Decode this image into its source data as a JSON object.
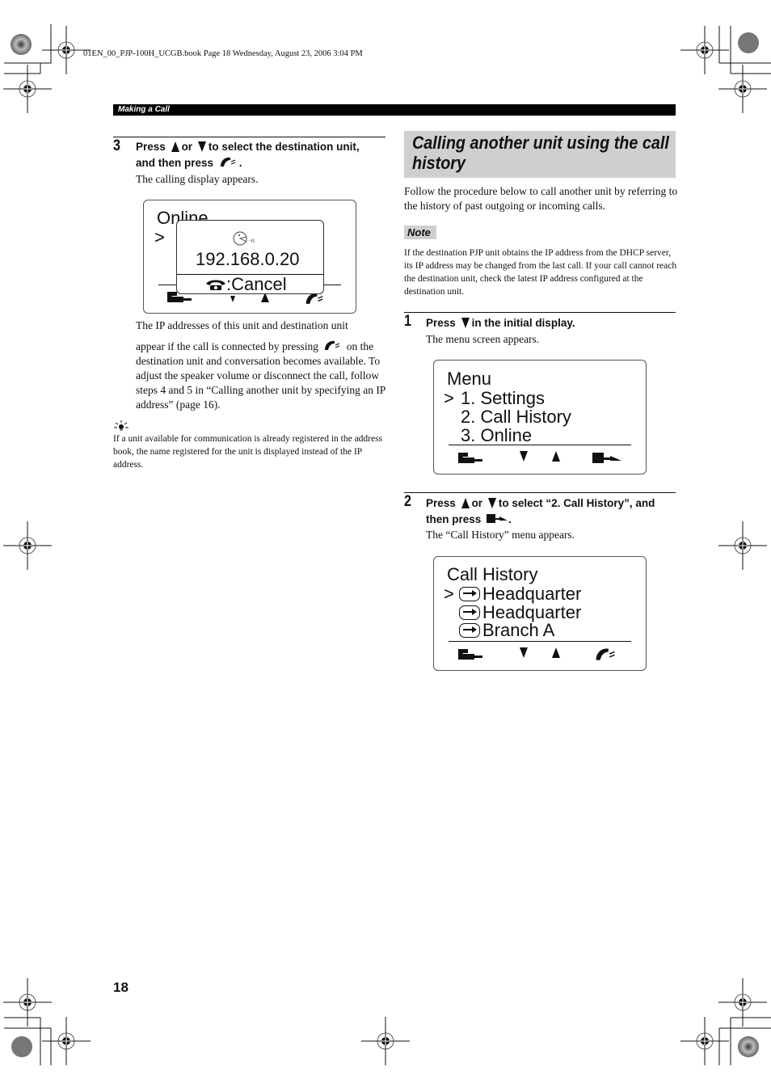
{
  "print_header": {
    "file_info": "01EN_00_PJP-100H_UCGB.book  Page 18  Wednesday, August 23, 2006  3:04 PM"
  },
  "section": {
    "label": "Making a Call"
  },
  "left_column": {
    "step3": {
      "number": "3",
      "line1_a": "Press",
      "line1_or": "or",
      "line1_b": "to select the destination unit,",
      "line2": "and then press",
      "line2_end": ".",
      "result": "The calling display appears."
    },
    "calling_display": {
      "background_title": "Online",
      "cursor": ">",
      "ip_address": "192.168.0.20",
      "cancel_label": ":Cancel"
    },
    "paragraph_line1": "The IP addresses of this unit and destination unit",
    "paragraph_line2a": "appear if the call is connected by pressing",
    "paragraph_line2b": "on the",
    "paragraph_rest": "destination unit and conversation becomes available. To adjust the speaker volume or disconnect the call, follow steps 4 and 5 in “Calling another unit by specifying an IP address” (page 16).",
    "hint": {
      "icon": "lightbulb-icon",
      "text": "If a unit available for communication is already registered in the address book, the name registered for the unit is displayed instead of the IP address."
    }
  },
  "right_column": {
    "heading": "Calling another unit using the call history",
    "intro": "Follow the procedure below to call another unit by referring to the history of past outgoing or incoming calls.",
    "note": {
      "label": "Note",
      "text": "If the destination PJP unit obtains the IP address from the DHCP server, its IP address may be changed from the last call. If your call cannot reach the destination unit, check the latest IP address configured at the destination unit."
    },
    "step1": {
      "number": "1",
      "head_a": "Press",
      "head_b": "in the initial display.",
      "result": "The menu screen appears."
    },
    "menu_display": {
      "title": "Menu",
      "cursor": ">",
      "items": [
        "1. Settings",
        "2. Call History",
        "3. Online"
      ]
    },
    "step2": {
      "number": "2",
      "line1_a": "Press",
      "line1_or": "or",
      "line1_b": "to select “2. Call History”, and",
      "line2": "then press",
      "line2_end": ".",
      "result": "The “Call History” menu appears."
    },
    "history_display": {
      "title": "Call History",
      "cursor": ">",
      "items": [
        "Headquarter",
        "Headquarter",
        "Branch A"
      ]
    }
  },
  "footer": {
    "page_number": "18"
  }
}
